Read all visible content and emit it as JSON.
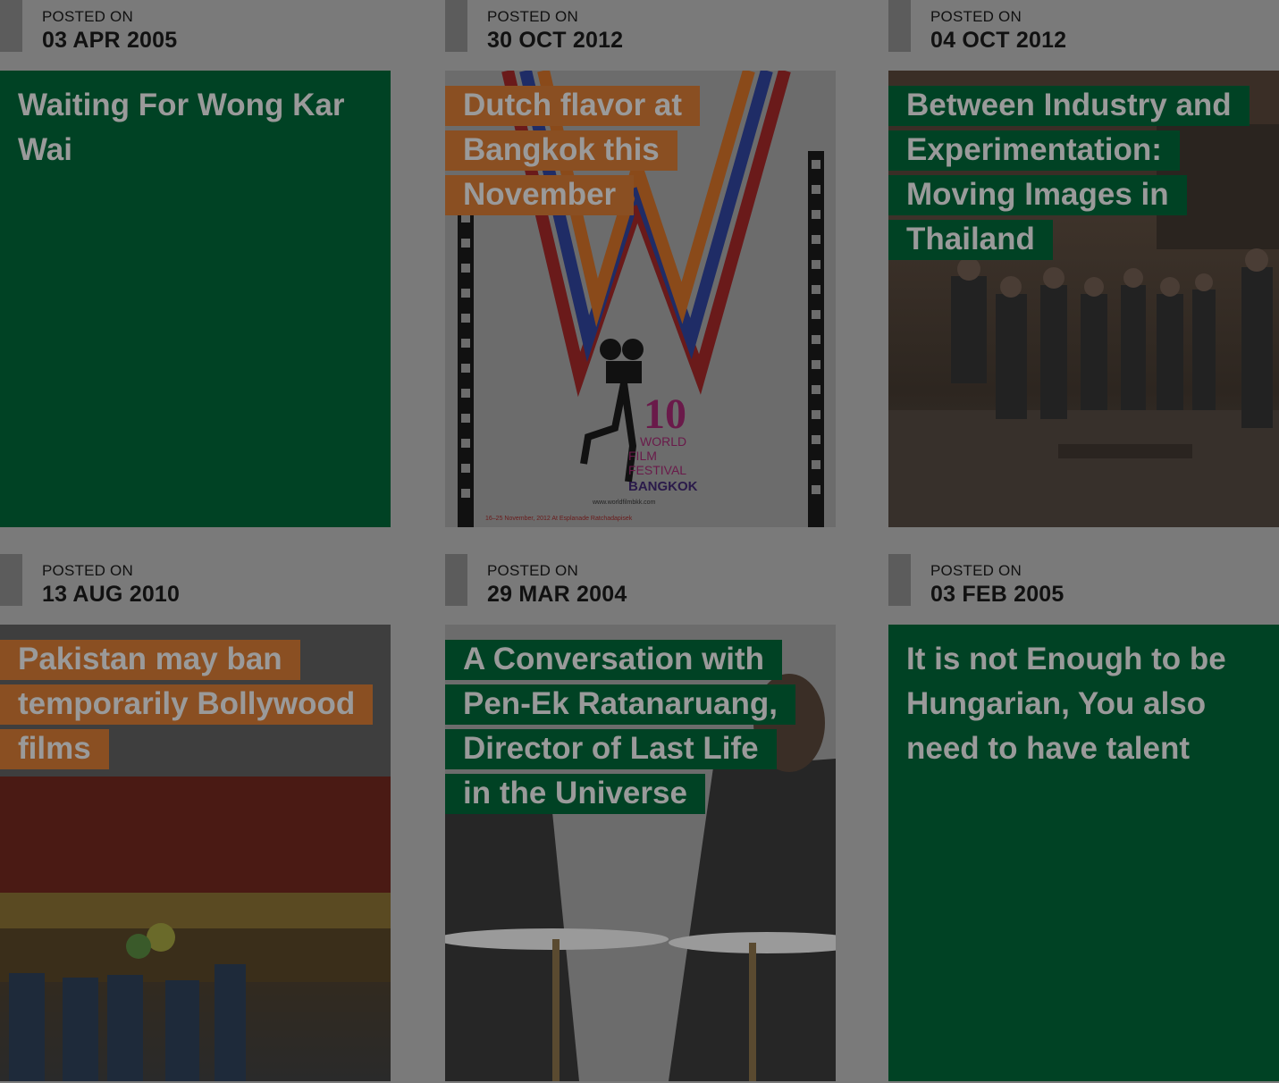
{
  "posts": [
    {
      "label": "POSTED ON",
      "date": "03 APR 2005",
      "title": "Waiting For Wong Kar Wai"
    },
    {
      "label": "POSTED ON",
      "date": "30 OCT 2012",
      "title": "Dutch flavor at Bangkok this November"
    },
    {
      "label": "POSTED ON",
      "date": "04 OCT 2012",
      "title": "Between Industry and Experimentation: Moving Images in Thailand"
    },
    {
      "label": "POSTED ON",
      "date": "13 AUG 2010",
      "title": "Pakistan may ban temporarily Bollywood films"
    },
    {
      "label": "POSTED ON",
      "date": "29 MAR 2004",
      "title": "A Conversation with Pen-Ek Ratanaruang, Director of Last Life in the Universe"
    },
    {
      "label": "POSTED ON",
      "date": "03 FEB 2005",
      "title": "It is not Enough to be Hungarian, You also need to have talent"
    }
  ],
  "poster_text": {
    "number": "10",
    "line1": "WORLD",
    "line2": "FILM",
    "line3": "FESTIVAL",
    "line4": "BANGKOK",
    "url": "www.worldfilmbkk.com",
    "footer": "16–25 November, 2012 At Esplanade Ratchadapisek"
  },
  "colors": {
    "background": "#7a7a7a",
    "card_green": "#004224",
    "title_brown": "#8a4f22",
    "title_text": "#9a9a9a"
  }
}
